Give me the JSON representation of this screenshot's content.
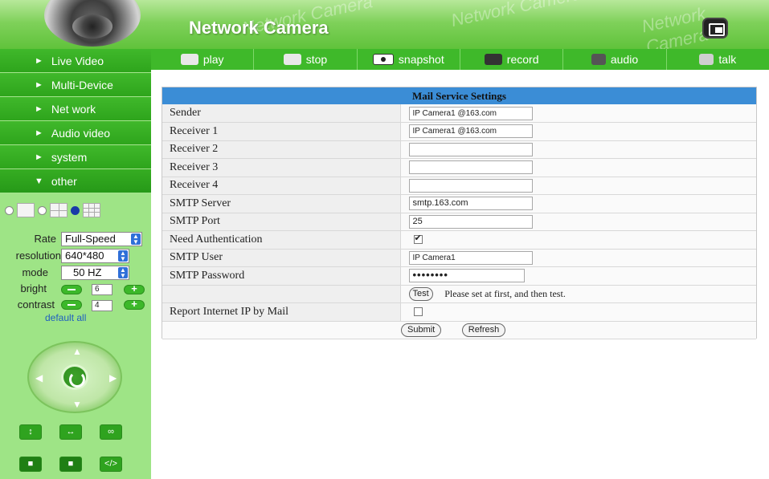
{
  "header": {
    "title": "Network Camera",
    "watermark": "Network Camera",
    "fullscreen_icon": "fullscreen-icon"
  },
  "toolbar": {
    "items": [
      {
        "label": "play",
        "icon": "play-icon"
      },
      {
        "label": "stop",
        "icon": "stop-icon"
      },
      {
        "label": "snapshot",
        "icon": "snapshot-icon"
      },
      {
        "label": "record",
        "icon": "record-icon"
      },
      {
        "label": "audio",
        "icon": "audio-icon"
      },
      {
        "label": "talk",
        "icon": "talk-icon"
      }
    ]
  },
  "sidebar": {
    "items": [
      {
        "label": "Live Video",
        "arrow": "►"
      },
      {
        "label": "Multi-Device",
        "arrow": "►"
      },
      {
        "label": "Net work",
        "arrow": "►"
      },
      {
        "label": "Audio video",
        "arrow": "►"
      },
      {
        "label": "system",
        "arrow": "►"
      },
      {
        "label": "other",
        "arrow": "▼"
      }
    ],
    "controls": {
      "rate_label": "Rate",
      "rate_value": "Full-Speed",
      "resolution_label": "resolution",
      "resolution_value": "640*480",
      "mode_label": "mode",
      "mode_value": "50 HZ",
      "bright_label": "bright",
      "bright_value": "6",
      "contrast_label": "contrast",
      "contrast_value": "4",
      "default_all": "default all"
    }
  },
  "panel": {
    "title": "Mail Service Settings",
    "rows": {
      "sender": {
        "label": "Sender",
        "value": "IP Camera1 @163.com"
      },
      "receiver1": {
        "label": "Receiver 1",
        "value": "IP Camera1 @163.com"
      },
      "receiver2": {
        "label": "Receiver 2",
        "value": ""
      },
      "receiver3": {
        "label": "Receiver 3",
        "value": ""
      },
      "receiver4": {
        "label": "Receiver 4",
        "value": ""
      },
      "smtp_server": {
        "label": "SMTP Server",
        "value": "smtp.163.com"
      },
      "smtp_port": {
        "label": "SMTP Port",
        "value": "25"
      },
      "need_auth": {
        "label": "Need Authentication",
        "checked": true
      },
      "smtp_user": {
        "label": "SMTP User",
        "value": "IP Camera1"
      },
      "smtp_password": {
        "label": "SMTP Password",
        "value": "••••••••"
      },
      "report_ip": {
        "label": "Report Internet IP by Mail",
        "checked": false
      }
    },
    "test_button": "Test",
    "test_hint": "Please set at first, and then test.",
    "submit_button": "Submit",
    "refresh_button": "Refresh"
  },
  "colors": {
    "accent_green": "#3fb92a",
    "panel_title_blue": "#3b8dd6",
    "sidebar_bg": "#9ee486"
  }
}
